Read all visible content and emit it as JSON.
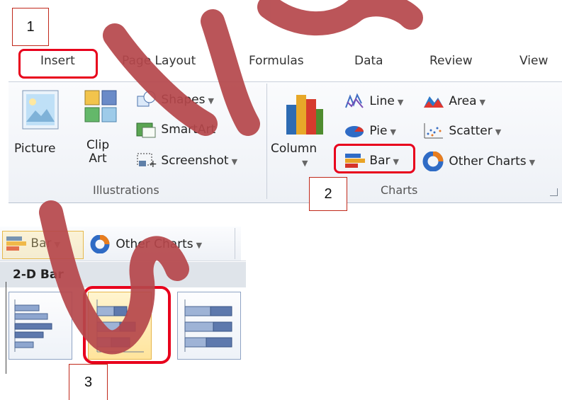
{
  "steps": [
    "1",
    "2",
    "3"
  ],
  "tabs": [
    "Insert",
    "Page Layout",
    "Formulas",
    "Data",
    "Review",
    "View"
  ],
  "illustrations": {
    "picture_label": "Picture",
    "clipart_label_line1": "Clip",
    "clipart_label_line2": "Art",
    "shapes_label": "Shapes",
    "smartart_label": "SmartArt",
    "screenshot_label": "Screenshot",
    "group_label": "Illustrations"
  },
  "charts": {
    "column_label": "Column",
    "line_label": "Line",
    "area_label": "Area",
    "pie_label": "Pie",
    "scatter_label": "Scatter",
    "bar_label": "Bar",
    "other_label": "Other Charts",
    "group_label": "Charts"
  },
  "dropdown": {
    "bar_label": "Bar",
    "other_label": "Other Charts",
    "section_title": "2-D Bar"
  },
  "colors": {
    "highlight": "#e8001c",
    "watermark": "#b5474b"
  }
}
